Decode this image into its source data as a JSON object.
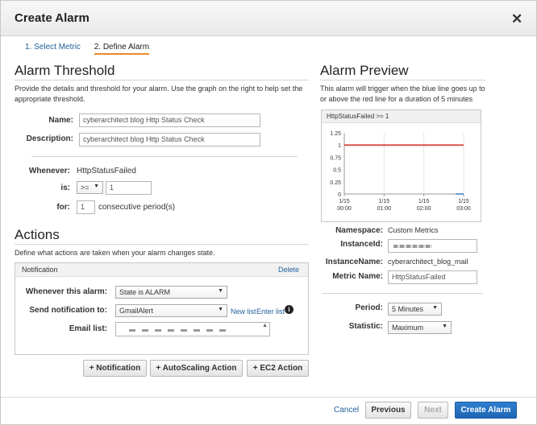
{
  "header": {
    "title": "Create Alarm"
  },
  "steps": {
    "step1": "1. Select Metric",
    "step2": "2. Define Alarm"
  },
  "threshold": {
    "heading": "Alarm Threshold",
    "description": "Provide the details and threshold for your alarm. Use the graph on the right to help set the appropriate threshold.",
    "name_label": "Name:",
    "name_value": "cyberarchitect blog Http Status Check",
    "description_label": "Description:",
    "description_value": "cyberarchitect blog Http Status Check",
    "whenever_label": "Whenever:",
    "whenever_value": "HttpStatusFailed",
    "is_label": "is:",
    "operator": ">=",
    "threshold_value": "1",
    "for_label": "for:",
    "periods_value": "1",
    "periods_suffix": "consecutive period(s)"
  },
  "actions": {
    "heading": "Actions",
    "description": "Define what actions are taken when your alarm changes state.",
    "notification_title": "Notification",
    "delete_link": "Delete",
    "whenever_alarm_label": "Whenever this alarm:",
    "state_value": "State is ALARM",
    "send_label": "Send notification to:",
    "send_value": "GmailAlert",
    "new_list_link": "New list",
    "enter_list_link": "Enter list",
    "email_label": "Email list:",
    "add_notification": "+ Notification",
    "add_autoscaling": "+ AutoScaling Action",
    "add_ec2": "+ EC2 Action"
  },
  "preview": {
    "heading": "Alarm Preview",
    "description": "This alarm will trigger when the blue line goes up to or above the red line for a duration of 5 minutes",
    "namespace_label": "Namespace:",
    "namespace_value": "Custom Metrics",
    "instanceid_label": "InstanceId:",
    "instancename_label": "InstanceName:",
    "instancename_value": "cyberarchitect_blog_mail",
    "metricname_label": "Metric Name:",
    "metricname_value": "HttpStatusFailed",
    "period_label": "Period:",
    "period_value": "5 Minutes",
    "statistic_label": "Statistic:",
    "statistic_value": "Maximum"
  },
  "chart_data": {
    "type": "line",
    "title": "HttpStatusFailed >= 1",
    "y_ticks": [
      "1.25",
      "1",
      "0.75",
      "0.5",
      "0.25",
      "0"
    ],
    "x_ticks": [
      [
        "1/15",
        "00:00"
      ],
      [
        "1/15",
        "01:00"
      ],
      [
        "1/15",
        "02:00"
      ],
      [
        "1/15",
        "03:00"
      ]
    ],
    "ylim": [
      0,
      1.25
    ],
    "xlim": [
      0,
      3
    ],
    "series": [
      {
        "color": "#d9534f",
        "x": [
          0,
          3
        ],
        "y": [
          1,
          1
        ]
      },
      {
        "color": "#3a7fc1",
        "x": [
          2.8,
          3
        ],
        "y": [
          0,
          0
        ]
      }
    ]
  },
  "footer": {
    "cancel": "Cancel",
    "previous": "Previous",
    "next": "Next",
    "create": "Create Alarm"
  }
}
